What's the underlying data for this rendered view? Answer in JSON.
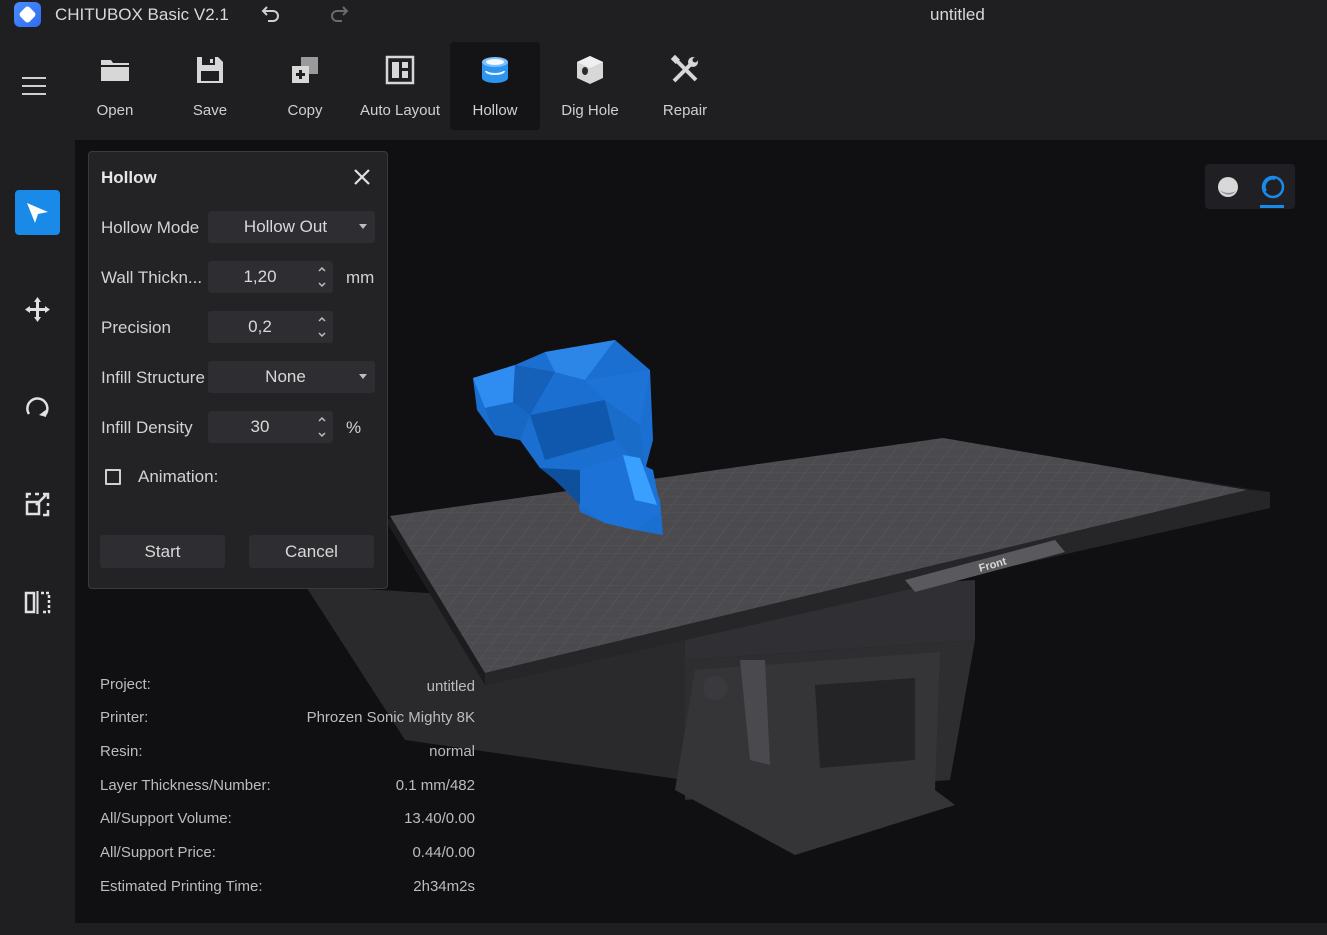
{
  "app": {
    "name": "CHITUBOX Basic V2.1",
    "document_title": "untitled"
  },
  "toolbar": {
    "items": [
      {
        "label": "Open",
        "icon": "folder-icon"
      },
      {
        "label": "Save",
        "icon": "floppy-icon"
      },
      {
        "label": "Copy",
        "icon": "copy-icon"
      },
      {
        "label": "Auto Layout",
        "icon": "layout-icon"
      },
      {
        "label": "Hollow",
        "icon": "hollow-icon",
        "active": true
      },
      {
        "label": "Dig Hole",
        "icon": "dig-hole-icon"
      },
      {
        "label": "Repair",
        "icon": "repair-icon"
      }
    ]
  },
  "rail": {
    "icons": [
      "select-icon",
      "move-icon",
      "rotate-icon",
      "scale-icon",
      "mirror-icon"
    ],
    "active": "select-icon"
  },
  "hollow_panel": {
    "title": "Hollow",
    "hollow_mode": {
      "label": "Hollow Mode",
      "value": "Hollow Out"
    },
    "wall_thickness": {
      "label": "Wall Thickn...",
      "value": "1,20",
      "unit": "mm"
    },
    "precision": {
      "label": "Precision",
      "value": "0,2"
    },
    "infill_structure": {
      "label": "Infill Structure",
      "value": "None"
    },
    "infill_density": {
      "label": "Infill Density",
      "value": "30",
      "unit": "%"
    },
    "animation": {
      "label": "Animation:",
      "checked": false
    },
    "start_label": "Start",
    "cancel_label": "Cancel"
  },
  "info": [
    {
      "key": "Project:",
      "value": "untitled"
    },
    {
      "key": "Printer:",
      "value": "Phrozen Sonic Mighty 8K"
    },
    {
      "key": "Resin:",
      "value": "normal"
    },
    {
      "key": "Layer Thickness/Number:",
      "value": "0.1 mm/482"
    },
    {
      "key": "All/Support Volume:",
      "value": "13.40/0.00"
    },
    {
      "key": "All/Support Price:",
      "value": "0.44/0.00"
    },
    {
      "key": "Estimated Printing Time:",
      "value": "2h34m2s"
    }
  ],
  "scene": {
    "plate_label": "Front",
    "model_color": "#1b73d6",
    "accent": "#1a8ae8"
  }
}
